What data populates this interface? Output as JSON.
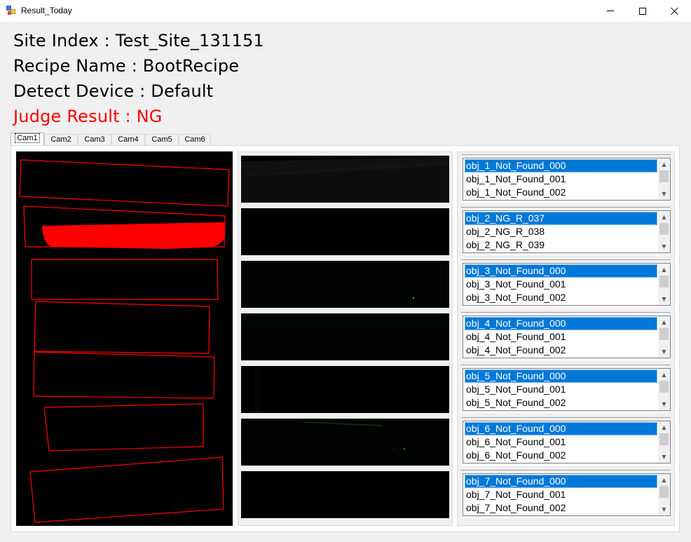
{
  "window": {
    "title": "Result_Today",
    "icon": "app-icon",
    "controls": [
      "minimize-icon",
      "maximize-icon",
      "close-icon"
    ]
  },
  "info": {
    "site_index": "Site Index : Test_Site_131151",
    "recipe_name": "Recipe Name : BootRecipe",
    "detect_device": "Detect Device : Default",
    "judge_result": "Judge Result : NG",
    "judge_color": "#ff0000"
  },
  "tabs": [
    {
      "label": "Cam1",
      "active": true
    },
    {
      "label": "Cam2",
      "active": false
    },
    {
      "label": "Cam3",
      "active": false
    },
    {
      "label": "Cam4",
      "active": false
    },
    {
      "label": "Cam5",
      "active": false
    },
    {
      "label": "Cam6",
      "active": false
    }
  ],
  "colors": {
    "region_outline": "#ff0000",
    "ng_fill": "#ff0000",
    "list_selection": "#0078d7",
    "image_background": "#000000"
  },
  "object_lists": [
    {
      "items": [
        "obj_1_Not_Found_000",
        "obj_1_Not_Found_001",
        "obj_1_Not_Found_002"
      ]
    },
    {
      "items": [
        "obj_2_NG_R_037",
        "obj_2_NG_R_038",
        "obj_2_NG_R_039"
      ]
    },
    {
      "items": [
        "obj_3_Not_Found_000",
        "obj_3_Not_Found_001",
        "obj_3_Not_Found_002"
      ]
    },
    {
      "items": [
        "obj_4_Not_Found_000",
        "obj_4_Not_Found_001",
        "obj_4_Not_Found_002"
      ]
    },
    {
      "items": [
        "obj_5_Not_Found_000",
        "obj_5_Not_Found_001",
        "obj_5_Not_Found_002"
      ]
    },
    {
      "items": [
        "obj_6_Not_Found_000",
        "obj_6_Not_Found_001",
        "obj_6_Not_Found_002"
      ]
    },
    {
      "items": [
        "obj_7_Not_Found_000",
        "obj_7_Not_Found_001",
        "obj_7_Not_Found_002"
      ]
    }
  ]
}
